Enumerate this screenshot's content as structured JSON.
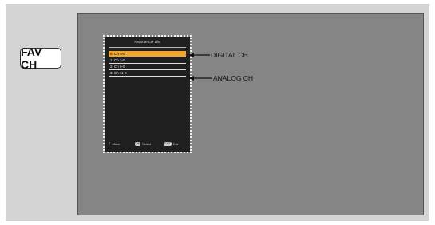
{
  "remote_button": {
    "label": "FAV CH"
  },
  "osd": {
    "title": "Favorite CH List",
    "channels": [
      {
        "label": "0. Ch 5-0",
        "selected": true
      },
      {
        "label": "1. Ch 7-0",
        "selected": false
      },
      {
        "label": "2. Ch 9-0",
        "selected": false
      },
      {
        "label": "3. Ch 11-0",
        "selected": false
      }
    ],
    "footer": {
      "move_label": "Move",
      "select_key": "OK",
      "select_label": "Select",
      "exit_key": "EXIT",
      "exit_label": "Exit"
    },
    "colors": {
      "highlight": "#f0a630",
      "window_bg": "#1f1f1f"
    }
  },
  "callouts": {
    "digital": "DIGITAL CH",
    "analog": "ANALOG CH"
  }
}
